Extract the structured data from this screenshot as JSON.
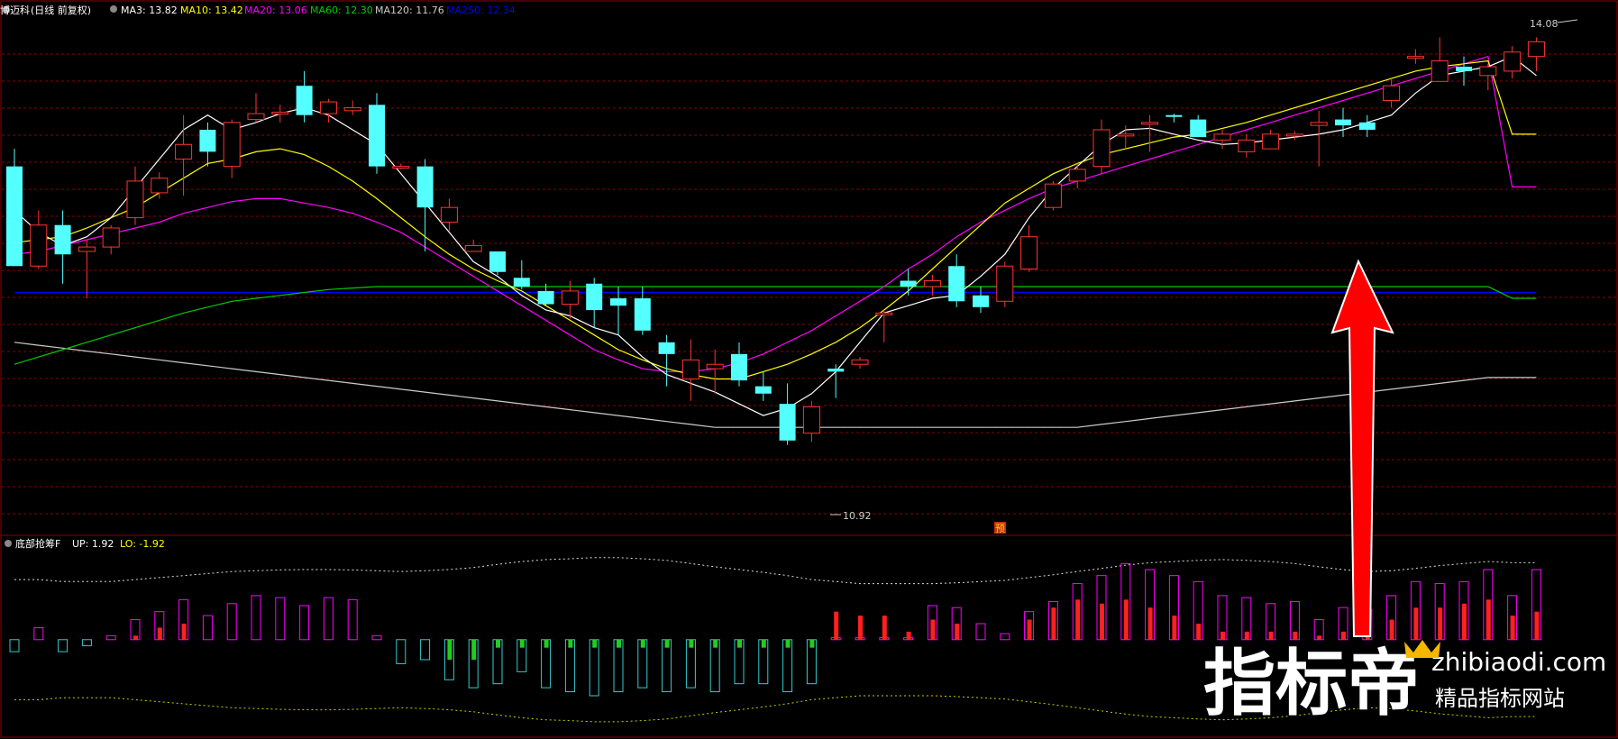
{
  "header": {
    "stock_name": "博迈科",
    "period": "(日线 前复权)",
    "mas": [
      {
        "label": "MA3: 13.82",
        "color": "#ffffff"
      },
      {
        "label": "MA10: 13.42",
        "color": "#ffff00"
      },
      {
        "label": "MA20: 13.06",
        "color": "#ff00ff"
      },
      {
        "label": "MA60: 12.30",
        "color": "#00cc00"
      },
      {
        "label": "MA120: 11.76",
        "color": "#cccccc"
      },
      {
        "label": "MA250: 12.34",
        "color": "#0000ff"
      }
    ]
  },
  "indicator_header": {
    "name": "底部抢筹F",
    "up": "UP: 1.92",
    "lo": "LO: -1.92"
  },
  "annotations": {
    "high_label": "14.08",
    "low_label": "10.92",
    "predict_label": "预"
  },
  "watermark": {
    "cn": "指标帝",
    "site": "zhibiaodi.com",
    "sub": "精品指标网站"
  },
  "colors": {
    "up": "#ff3333",
    "down": "#54ffff",
    "grid": "#8b0000",
    "ma3": "#ffffff",
    "ma10": "#ffff00",
    "ma20": "#ff00ff",
    "ma60": "#00cc00",
    "ma120": "#cccccc",
    "ma250": "#0000ff",
    "arrow": "#ff0000"
  },
  "chart_data": {
    "type": "candlestick",
    "price_range": [
      10.8,
      14.2
    ],
    "candles": [
      [
        13.2,
        12.52,
        13.32,
        12.52
      ],
      [
        12.52,
        12.8,
        12.9,
        12.5
      ],
      [
        12.8,
        12.6,
        12.9,
        12.4
      ],
      [
        12.62,
        12.65,
        12.7,
        12.3
      ],
      [
        12.65,
        12.78,
        12.8,
        12.6
      ],
      [
        12.85,
        13.1,
        13.2,
        12.8
      ],
      [
        13.02,
        13.12,
        13.16,
        12.98
      ],
      [
        13.25,
        13.35,
        13.55,
        13.0
      ],
      [
        13.45,
        13.3,
        13.5,
        13.2
      ],
      [
        13.2,
        13.5,
        13.52,
        13.12
      ],
      [
        13.52,
        13.56,
        13.7,
        13.5
      ],
      [
        13.57,
        13.57,
        13.62,
        13.5
      ],
      [
        13.75,
        13.55,
        13.85,
        13.5
      ],
      [
        13.56,
        13.64,
        13.66,
        13.5
      ],
      [
        13.58,
        13.6,
        13.65,
        13.55
      ],
      [
        13.62,
        13.2,
        13.7,
        13.15
      ],
      [
        13.2,
        13.2,
        13.22,
        13.18
      ],
      [
        13.2,
        12.92,
        13.25,
        12.62
      ],
      [
        12.82,
        12.92,
        12.98,
        12.76
      ],
      [
        12.62,
        12.66,
        12.7,
        12.62
      ],
      [
        12.62,
        12.48,
        12.62,
        12.46
      ],
      [
        12.44,
        12.38,
        12.56,
        12.36
      ],
      [
        12.35,
        12.26,
        12.4,
        12.25
      ],
      [
        12.26,
        12.35,
        12.42,
        12.16
      ],
      [
        12.4,
        12.22,
        12.44,
        12.1
      ],
      [
        12.3,
        12.25,
        12.38,
        12.05
      ],
      [
        12.3,
        12.08,
        12.38,
        12.05
      ],
      [
        12.0,
        11.92,
        12.05,
        11.7
      ],
      [
        11.75,
        11.88,
        12.02,
        11.6
      ],
      [
        11.82,
        11.85,
        11.95,
        11.65
      ],
      [
        11.92,
        11.74,
        12.0,
        11.7
      ],
      [
        11.7,
        11.65,
        11.8,
        11.6
      ],
      [
        11.58,
        11.33,
        11.72,
        11.3
      ],
      [
        11.38,
        11.56,
        11.6,
        11.32
      ],
      [
        11.82,
        11.8,
        11.85,
        11.62
      ],
      [
        11.85,
        11.88,
        11.9,
        11.82
      ],
      [
        12.2,
        12.2,
        12.22,
        12.0
      ],
      [
        12.42,
        12.38,
        12.5,
        12.32
      ],
      [
        12.38,
        12.42,
        12.46,
        12.32
      ],
      [
        12.52,
        12.28,
        12.6,
        12.24
      ],
      [
        12.32,
        12.24,
        12.38,
        12.2
      ],
      [
        12.28,
        12.52,
        12.55,
        12.24
      ],
      [
        12.5,
        12.72,
        12.8,
        12.48
      ],
      [
        12.92,
        13.08,
        13.1,
        12.9
      ],
      [
        13.1,
        13.18,
        13.22,
        13.05
      ],
      [
        13.2,
        13.45,
        13.52,
        13.15
      ],
      [
        13.42,
        13.42,
        13.48,
        13.32
      ],
      [
        13.5,
        13.5,
        13.55,
        13.3
      ],
      [
        13.55,
        13.54,
        13.56,
        13.5
      ],
      [
        13.52,
        13.4,
        13.55,
        13.4
      ],
      [
        13.38,
        13.42,
        13.45,
        13.32
      ],
      [
        13.3,
        13.38,
        13.42,
        13.26
      ],
      [
        13.32,
        13.42,
        13.45,
        13.35
      ],
      [
        13.42,
        13.42,
        13.44,
        13.38
      ],
      [
        13.48,
        13.5,
        13.58,
        13.2
      ],
      [
        13.52,
        13.48,
        13.6,
        13.4
      ],
      [
        13.5,
        13.45,
        13.55,
        13.4
      ],
      [
        13.65,
        13.75,
        13.8,
        13.6
      ],
      [
        13.95,
        13.95,
        14.0,
        13.9
      ],
      [
        13.78,
        13.92,
        14.08,
        13.82
      ],
      [
        13.88,
        13.85,
        13.95,
        13.75
      ],
      [
        13.82,
        13.88,
        13.9,
        13.72
      ],
      [
        13.85,
        13.98,
        14.02,
        13.8
      ],
      [
        13.95,
        14.05,
        14.08,
        13.85
      ]
    ],
    "ma3": [
      12.9,
      12.75,
      12.66,
      12.72,
      12.85,
      13.05,
      13.25,
      13.45,
      13.55,
      13.45,
      13.5,
      13.56,
      13.6,
      13.55,
      13.45,
      13.35,
      13.15,
      12.95,
      12.75,
      12.55,
      12.45,
      12.32,
      12.22,
      12.18,
      12.1,
      12.05,
      11.9,
      11.78,
      11.72,
      11.66,
      11.58,
      11.5,
      11.55,
      11.65,
      11.8,
      12.0,
      12.2,
      12.25,
      12.3,
      12.32,
      12.45,
      12.6,
      12.85,
      13.05,
      13.2,
      13.35,
      13.45,
      13.46,
      13.42,
      13.38,
      13.35,
      13.36,
      13.38,
      13.4,
      13.42,
      13.45,
      13.5,
      13.55,
      13.7,
      13.82,
      13.85,
      13.88,
      13.95,
      13.82
    ],
    "ma10": [
      12.68,
      12.7,
      12.72,
      12.78,
      12.85,
      12.92,
      13.02,
      13.12,
      13.22,
      13.25,
      13.3,
      13.32,
      13.28,
      13.2,
      13.1,
      12.98,
      12.85,
      12.72,
      12.6,
      12.5,
      12.42,
      12.35,
      12.25,
      12.15,
      12.05,
      11.95,
      11.88,
      11.82,
      11.78,
      11.75,
      11.75,
      11.8,
      11.85,
      11.92,
      12.0,
      12.1,
      12.22,
      12.35,
      12.5,
      12.65,
      12.8,
      12.95,
      13.05,
      13.15,
      13.22,
      13.28,
      13.32,
      13.36,
      13.4,
      13.42,
      13.46,
      13.5,
      13.55,
      13.6,
      13.65,
      13.7,
      13.75,
      13.8,
      13.85,
      13.88,
      13.9,
      13.92,
      13.42,
      13.42
    ],
    "ma20": [
      12.6,
      12.62,
      12.66,
      12.7,
      12.74,
      12.78,
      12.82,
      12.88,
      12.92,
      12.96,
      12.98,
      12.98,
      12.95,
      12.92,
      12.88,
      12.82,
      12.75,
      12.65,
      12.55,
      12.45,
      12.35,
      12.25,
      12.15,
      12.05,
      11.95,
      11.88,
      11.82,
      11.8,
      11.8,
      11.82,
      11.86,
      11.92,
      12.0,
      12.08,
      12.18,
      12.28,
      12.38,
      12.5,
      12.6,
      12.72,
      12.82,
      12.9,
      12.98,
      13.05,
      13.1,
      13.15,
      13.2,
      13.25,
      13.3,
      13.35,
      13.4,
      13.45,
      13.5,
      13.55,
      13.6,
      13.65,
      13.7,
      13.75,
      13.8,
      13.85,
      13.9,
      13.95,
      13.06,
      13.06
    ],
    "ma60": [
      11.85,
      11.9,
      11.95,
      12.0,
      12.05,
      12.1,
      12.15,
      12.2,
      12.24,
      12.28,
      12.3,
      12.32,
      12.34,
      12.36,
      12.37,
      12.38,
      12.38,
      12.38,
      12.38,
      12.38,
      12.38,
      12.38,
      12.38,
      12.38,
      12.38,
      12.38,
      12.38,
      12.38,
      12.38,
      12.38,
      12.38,
      12.38,
      12.38,
      12.38,
      12.38,
      12.38,
      12.38,
      12.38,
      12.38,
      12.38,
      12.38,
      12.38,
      12.38,
      12.38,
      12.38,
      12.38,
      12.38,
      12.38,
      12.38,
      12.38,
      12.38,
      12.38,
      12.38,
      12.38,
      12.38,
      12.38,
      12.38,
      12.38,
      12.38,
      12.38,
      12.38,
      12.38,
      12.3,
      12.3
    ],
    "ma120": [
      12.0,
      11.98,
      11.96,
      11.94,
      11.92,
      11.9,
      11.88,
      11.86,
      11.84,
      11.82,
      11.8,
      11.78,
      11.76,
      11.74,
      11.72,
      11.7,
      11.68,
      11.66,
      11.64,
      11.62,
      11.6,
      11.58,
      11.56,
      11.54,
      11.52,
      11.5,
      11.48,
      11.46,
      11.44,
      11.42,
      11.42,
      11.42,
      11.42,
      11.42,
      11.42,
      11.42,
      11.42,
      11.42,
      11.42,
      11.42,
      11.42,
      11.42,
      11.42,
      11.42,
      11.42,
      11.44,
      11.46,
      11.48,
      11.5,
      11.52,
      11.54,
      11.56,
      11.58,
      11.6,
      11.62,
      11.64,
      11.66,
      11.68,
      11.7,
      11.72,
      11.74,
      11.76,
      11.76,
      11.76
    ],
    "ma250": [
      12.34,
      12.34,
      12.34,
      12.34,
      12.34,
      12.34,
      12.34,
      12.34,
      12.34,
      12.34,
      12.34,
      12.34,
      12.34,
      12.34,
      12.34,
      12.34,
      12.34,
      12.34,
      12.34,
      12.34,
      12.34,
      12.34,
      12.34,
      12.34,
      12.34,
      12.34,
      12.34,
      12.34,
      12.34,
      12.34,
      12.34,
      12.34,
      12.34,
      12.34,
      12.34,
      12.34,
      12.34,
      12.34,
      12.34,
      12.34,
      12.34,
      12.34,
      12.34,
      12.34,
      12.34,
      12.34,
      12.34,
      12.34,
      12.34,
      12.34,
      12.34,
      12.34,
      12.34,
      12.34,
      12.34,
      12.34,
      12.34,
      12.34,
      12.34,
      12.34,
      12.34,
      12.34,
      12.34,
      12.34
    ],
    "indicator": {
      "range": [
        -2.3,
        2.2
      ],
      "up_band": [
        1.5,
        1.5,
        1.45,
        1.45,
        1.45,
        1.5,
        1.55,
        1.6,
        1.65,
        1.7,
        1.72,
        1.74,
        1.75,
        1.75,
        1.74,
        1.72,
        1.7,
        1.72,
        1.75,
        1.8,
        1.88,
        1.95,
        2.0,
        2.02,
        2.05,
        2.05,
        2.02,
        1.98,
        1.9,
        1.82,
        1.75,
        1.68,
        1.6,
        1.5,
        1.45,
        1.4,
        1.4,
        1.4,
        1.4,
        1.42,
        1.45,
        1.48,
        1.55,
        1.62,
        1.7,
        1.78,
        1.86,
        1.92,
        1.95,
        1.98,
        2.0,
        1.98,
        1.95,
        1.9,
        1.82,
        1.75,
        1.7,
        1.72,
        1.78,
        1.85,
        1.9,
        1.95,
        1.92,
        1.92
      ],
      "lo_band": [
        -1.5,
        -1.5,
        -1.45,
        -1.45,
        -1.45,
        -1.5,
        -1.55,
        -1.6,
        -1.65,
        -1.7,
        -1.72,
        -1.74,
        -1.75,
        -1.75,
        -1.74,
        -1.72,
        -1.7,
        -1.72,
        -1.75,
        -1.8,
        -1.88,
        -1.95,
        -2.0,
        -2.02,
        -2.05,
        -2.05,
        -2.02,
        -1.98,
        -1.9,
        -1.82,
        -1.75,
        -1.68,
        -1.6,
        -1.5,
        -1.45,
        -1.4,
        -1.4,
        -1.4,
        -1.4,
        -1.42,
        -1.45,
        -1.48,
        -1.55,
        -1.62,
        -1.7,
        -1.78,
        -1.86,
        -1.92,
        -1.95,
        -1.98,
        -2.0,
        -1.98,
        -1.95,
        -1.9,
        -1.82,
        -1.75,
        -1.7,
        -1.72,
        -1.78,
        -1.85,
        -1.9,
        -1.95,
        -1.92,
        -1.92
      ],
      "bars": [
        -0.3,
        0.3,
        -0.3,
        -0.15,
        0.1,
        0.5,
        0.7,
        1.0,
        0.6,
        0.9,
        1.1,
        1.05,
        0.85,
        1.05,
        1.0,
        0.1,
        -0.6,
        -0.5,
        -1.0,
        -1.2,
        -1.1,
        -0.8,
        -1.2,
        -1.3,
        -1.4,
        -1.3,
        -1.2,
        -1.3,
        -1.2,
        -1.3,
        -1.1,
        -1.1,
        -1.3,
        -1.1,
        0.05,
        0.05,
        0.05,
        0.05,
        0.85,
        0.8,
        0.4,
        0.15,
        0.7,
        0.95,
        1.4,
        1.6,
        1.9,
        1.75,
        1.6,
        1.45,
        1.1,
        1.05,
        0.9,
        0.95,
        0.5,
        0.8,
        0.75,
        1.1,
        1.45,
        1.4,
        1.45,
        1.75,
        1.1,
        1.75
      ],
      "inner": [
        0.0,
        0.0,
        0.0,
        0.0,
        0.0,
        0.1,
        0.3,
        0.4,
        0.0,
        0.0,
        0.0,
        0.0,
        0.0,
        0.0,
        0.0,
        0.0,
        0.0,
        0.0,
        -0.5,
        -0.5,
        -0.2,
        -0.2,
        -0.2,
        -0.2,
        -0.2,
        -0.2,
        -0.2,
        -0.2,
        -0.2,
        -0.2,
        -0.2,
        -0.2,
        -0.2,
        -0.2,
        0.7,
        0.6,
        0.6,
        0.2,
        0.5,
        0.4,
        0.0,
        0.0,
        0.5,
        0.8,
        1.0,
        0.9,
        1.0,
        0.8,
        0.6,
        0.4,
        0.2,
        0.2,
        0.2,
        0.2,
        0.1,
        0.2,
        0.2,
        0.5,
        0.8,
        0.8,
        0.9,
        1.0,
        0.6,
        0.7
      ]
    }
  }
}
